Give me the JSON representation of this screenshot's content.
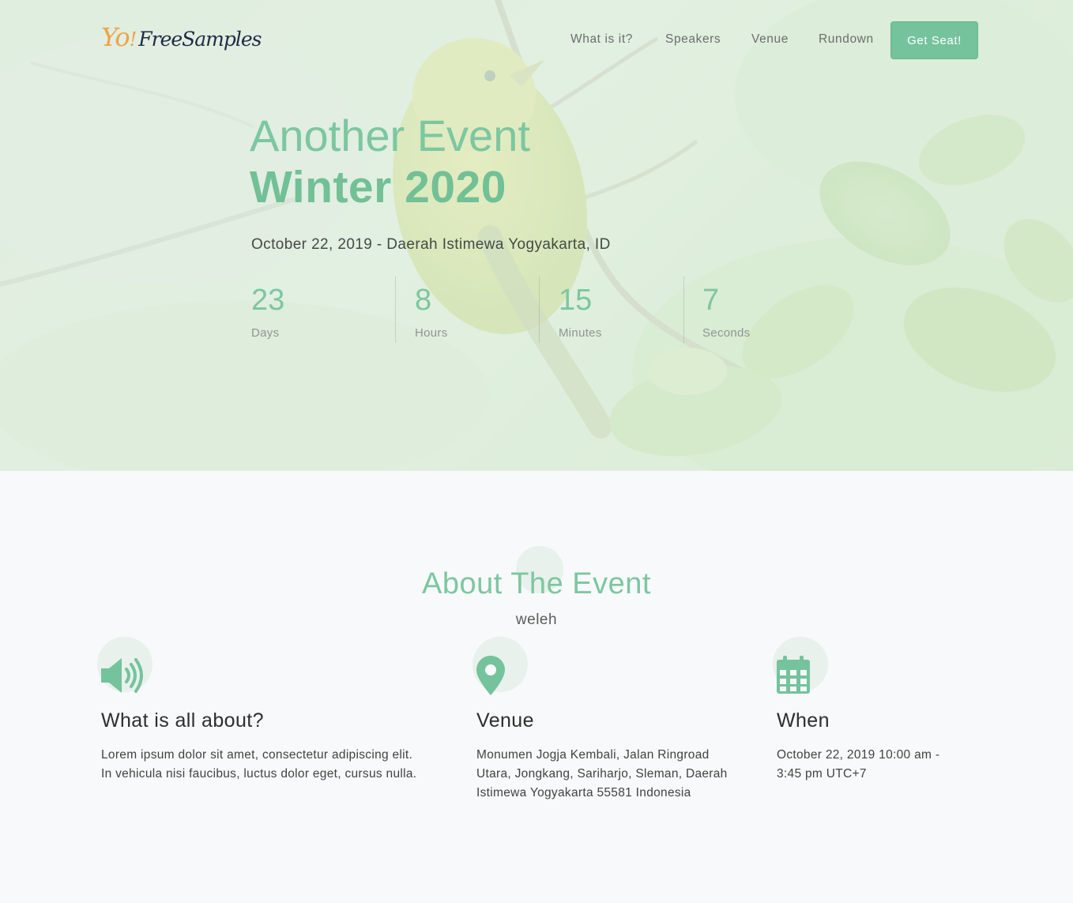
{
  "brand": {
    "logo_yo": "Yo",
    "logo_bang": "!",
    "logo_name": "FreeSamples"
  },
  "nav": {
    "items": [
      {
        "label": "What is it?"
      },
      {
        "label": "Speakers"
      },
      {
        "label": "Venue"
      },
      {
        "label": "Rundown"
      }
    ],
    "cta_label": "Get Seat!"
  },
  "hero": {
    "kicker": "Another Event",
    "title": "Winter 2020",
    "subtitle": "October 22, 2019 - Daerah Istimewa Yogyakarta, ID",
    "countdown": [
      {
        "value": "23",
        "label": "Days"
      },
      {
        "value": "8",
        "label": "Hours"
      },
      {
        "value": "15",
        "label": "Minutes"
      },
      {
        "value": "7",
        "label": "Seconds"
      }
    ]
  },
  "about": {
    "title": "About The Event",
    "subtitle": "weleh",
    "features": [
      {
        "icon": "speaker-icon",
        "title": "What is all about?",
        "text_lines": [
          "Lorem ipsum dolor sit amet, consectetur adipiscing elit.",
          "In vehicula nisi faucibus, luctus dolor eget, cursus nulla."
        ]
      },
      {
        "icon": "map-pin-icon",
        "title": "Venue",
        "text_lines": [
          "Monumen Jogja Kembali, Jalan Ringroad",
          "Utara, Jongkang, Sariharjo, Sleman, Daerah",
          "Istimewa Yogyakarta 55581 Indonesia"
        ]
      },
      {
        "icon": "calendar-icon",
        "title": "When",
        "text_lines": [
          "October 22, 2019 10:00 am -",
          "3:45 pm UTC+7"
        ]
      }
    ]
  },
  "colors": {
    "accent": "#74c39d",
    "logo_orange": "#f0a245",
    "logo_navy": "#1f2a44"
  }
}
